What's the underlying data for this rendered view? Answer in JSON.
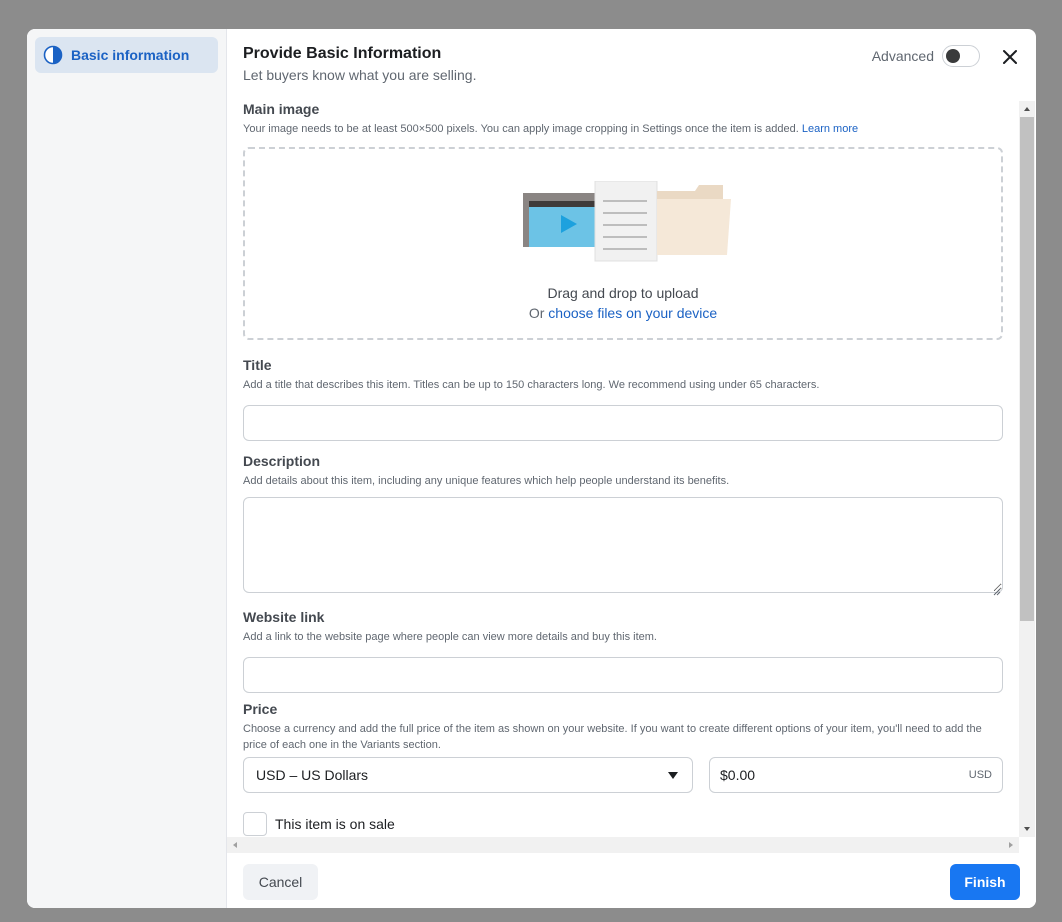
{
  "sidebar": {
    "items": [
      {
        "label": "Basic information",
        "icon": "half-circle-icon"
      }
    ]
  },
  "header": {
    "title": "Provide Basic Information",
    "subtitle": "Let buyers know what you are selling.",
    "advanced_label": "Advanced",
    "advanced_on": false
  },
  "main_image": {
    "label": "Main image",
    "help": "Your image needs to be at least 500×500 pixels. You can apply image cropping in Settings once the item is added.",
    "learn_more": "Learn more",
    "drop_text": "Drag and drop to upload",
    "or_text": "Or",
    "choose_link": "choose files on your device"
  },
  "title_field": {
    "label": "Title",
    "help": "Add a title that describes this item. Titles can be up to 150 characters long. We recommend using under 65 characters.",
    "value": ""
  },
  "description_field": {
    "label": "Description",
    "help": "Add details about this item, including any unique features which help people understand its benefits.",
    "value": ""
  },
  "website_field": {
    "label": "Website link",
    "help": "Add a link to the website page where people can view more details and buy this item.",
    "value": ""
  },
  "price": {
    "label": "Price",
    "help": "Choose a currency and add the full price of the item as shown on your website. If you want to create different options of your item, you'll need to add the price of each one in the Variants section.",
    "currency_selected": "USD – US Dollars",
    "amount": "$0.00",
    "currency_code": "USD"
  },
  "sale": {
    "label": "This item is on sale",
    "checked": false
  },
  "footer": {
    "cancel_label": "Cancel",
    "finish_label": "Finish"
  },
  "colors": {
    "primary": "#1877f2",
    "link": "#1b62c4",
    "sidebar_active": "#dbe5f1"
  }
}
